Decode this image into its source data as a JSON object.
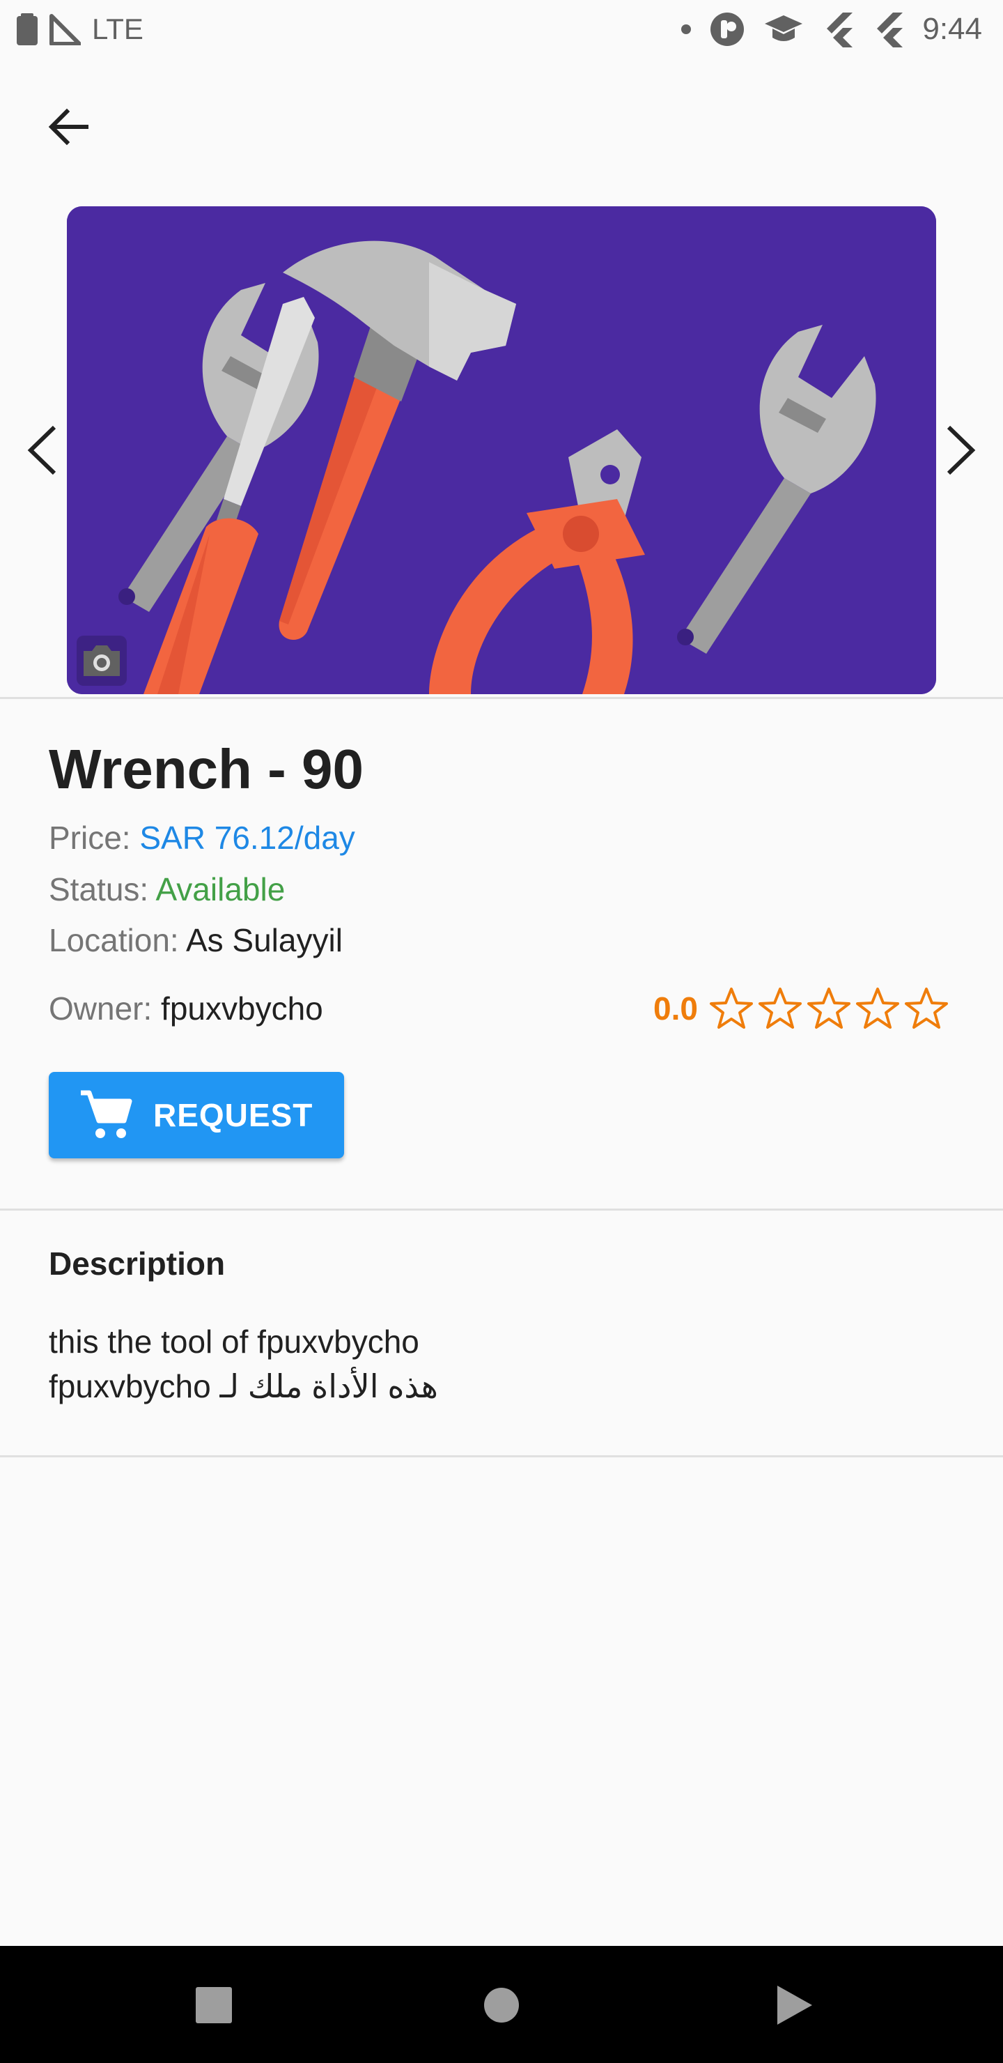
{
  "status_bar": {
    "network": "LTE",
    "time": "9:44"
  },
  "tool": {
    "title": "Wrench - 90",
    "price_label": "Price:",
    "price_value": "SAR 76.12/day",
    "status_label": "Status:",
    "status_value": "Available",
    "location_label": "Location:",
    "location_value": "As Sulayyil",
    "owner_label": "Owner:",
    "owner_value": "fpuxvbycho",
    "rating_value": "0.0",
    "rating_stars_filled": 0,
    "rating_stars_total": 5
  },
  "actions": {
    "request_label": "REQUEST"
  },
  "description": {
    "title": "Description",
    "line1": "this the tool of fpuxvbycho",
    "line2": "هذه الأداة ملك لـ fpuxvbycho"
  },
  "colors": {
    "accent": "#2196f3",
    "price": "#1e88e5",
    "status_available": "#43a047",
    "rating": "#ef7d0b",
    "hero_background": "#4b2aa1"
  },
  "icons": {
    "back": "arrow-left-icon",
    "prev": "chevron-left-icon",
    "next": "chevron-right-icon",
    "camera": "camera-icon",
    "cart": "shopping-cart-icon",
    "star": "star-outline-icon"
  }
}
